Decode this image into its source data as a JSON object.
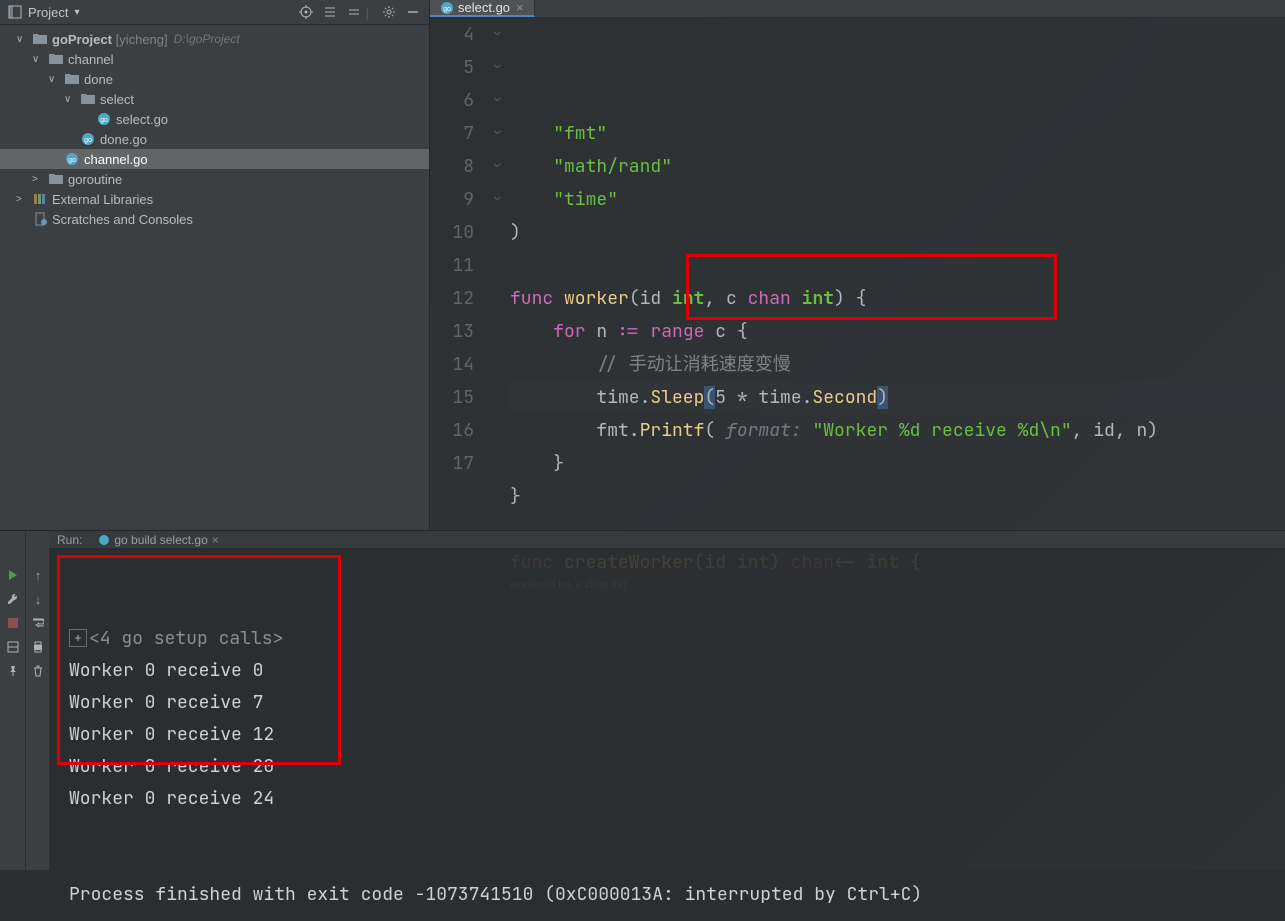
{
  "project_header": {
    "label": "Project"
  },
  "tree": {
    "root": {
      "name": "goProject",
      "hint": "[yicheng]",
      "path": "D:\\goProject"
    },
    "items": [
      {
        "indent": 1,
        "arrow": "∨",
        "type": "folder",
        "label": "channel"
      },
      {
        "indent": 2,
        "arrow": "∨",
        "type": "folder",
        "label": "done"
      },
      {
        "indent": 3,
        "arrow": "∨",
        "type": "folder",
        "label": "select"
      },
      {
        "indent": 4,
        "arrow": "",
        "type": "gofile",
        "label": "select.go"
      },
      {
        "indent": 3,
        "arrow": "",
        "type": "gofile",
        "label": "done.go"
      },
      {
        "indent": 2,
        "arrow": "",
        "type": "gofile",
        "label": "channel.go",
        "selected": true
      },
      {
        "indent": 1,
        "arrow": ">",
        "type": "folder",
        "label": "goroutine"
      },
      {
        "indent": 0,
        "arrow": ">",
        "type": "lib",
        "label": "External Libraries"
      },
      {
        "indent": 0,
        "arrow": "",
        "type": "scratch",
        "label": "Scratches and Consoles"
      }
    ]
  },
  "tabs": {
    "active": {
      "label": "select.go"
    }
  },
  "code": {
    "lines": [
      {
        "n": 4,
        "fold": "",
        "tokens": [
          [
            "    ",
            ""
          ],
          [
            "\"fmt\"",
            "str"
          ]
        ]
      },
      {
        "n": 5,
        "fold": "",
        "tokens": [
          [
            "    ",
            ""
          ],
          [
            "\"math/rand\"",
            "str"
          ]
        ]
      },
      {
        "n": 6,
        "fold": "",
        "tokens": [
          [
            "    ",
            ""
          ],
          [
            "\"time\"",
            "str"
          ]
        ]
      },
      {
        "n": 7,
        "fold": "⌄",
        "tokens": [
          [
            ")",
            ""
          ]
        ]
      },
      {
        "n": 8,
        "fold": "",
        "tokens": [
          [
            "",
            ""
          ]
        ]
      },
      {
        "n": 9,
        "fold": "⌄",
        "tokens": [
          [
            "func ",
            "kw"
          ],
          [
            "worker",
            "fn"
          ],
          [
            "(id ",
            ""
          ],
          [
            "int",
            "type"
          ],
          [
            ", c ",
            ""
          ],
          [
            "chan",
            "kw"
          ],
          [
            " ",
            ""
          ],
          [
            "int",
            "type"
          ],
          [
            ") {",
            ""
          ]
        ]
      },
      {
        "n": 10,
        "fold": "⌄",
        "tokens": [
          [
            "    ",
            ""
          ],
          [
            "for",
            "kw"
          ],
          [
            " n ",
            ""
          ],
          [
            ":=",
            "kw"
          ],
          [
            " ",
            ""
          ],
          [
            "range",
            "kw"
          ],
          [
            " c {",
            ""
          ]
        ]
      },
      {
        "n": 11,
        "fold": "",
        "tokens": [
          [
            "        ",
            ""
          ],
          [
            "// 手动让消耗速度变慢",
            "cm"
          ]
        ]
      },
      {
        "n": 12,
        "fold": "",
        "current": true,
        "tokens": [
          [
            "        time.",
            ""
          ],
          [
            "Sleep",
            "fn"
          ],
          [
            "(",
            "paren-hl"
          ],
          [
            "5 * time.",
            ""
          ],
          [
            "Second",
            "fn"
          ],
          [
            ")",
            "paren-hl"
          ]
        ]
      },
      {
        "n": 13,
        "fold": "",
        "tokens": [
          [
            "        fmt.",
            ""
          ],
          [
            "Printf",
            "fn"
          ],
          [
            "( ",
            ""
          ],
          [
            "format:",
            "hint"
          ],
          [
            " ",
            ""
          ],
          [
            "\"Worker %d receive %d\\n\"",
            "str"
          ],
          [
            ", id, n)",
            ""
          ]
        ]
      },
      {
        "n": 14,
        "fold": "⌄",
        "tokens": [
          [
            "    }",
            ""
          ]
        ]
      },
      {
        "n": 15,
        "fold": "⌄",
        "tokens": [
          [
            "}",
            ""
          ]
        ]
      },
      {
        "n": 16,
        "fold": "",
        "tokens": [
          [
            "",
            ""
          ]
        ]
      },
      {
        "n": 17,
        "fold": "⌄",
        "tokens": [
          [
            "func ",
            "kw"
          ],
          [
            "createWorker",
            "fn"
          ],
          [
            "(id ",
            ""
          ],
          [
            "int",
            "type"
          ],
          [
            ") ",
            ""
          ],
          [
            "chan",
            "kw"
          ],
          [
            "<- ",
            ""
          ],
          [
            "int",
            "type"
          ],
          [
            " {",
            ""
          ]
        ]
      }
    ],
    "breadcrumb": "worker(id int, c chan int)"
  },
  "run": {
    "label": "Run:",
    "tab": "go build select.go",
    "output": [
      "<4 go setup calls>",
      "Worker 0 receive 0",
      "Worker 0 receive 7",
      "Worker 0 receive 12",
      "Worker 0 receive 20",
      "Worker 0 receive 24",
      "",
      "",
      "Process finished with exit code -1073741510 (0xC000013A: interrupted by Ctrl+C)"
    ]
  }
}
